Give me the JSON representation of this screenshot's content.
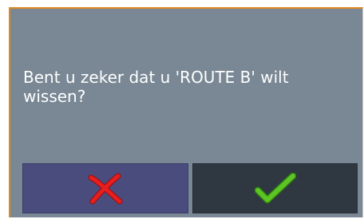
{
  "dialog": {
    "message": "Bent u zeker dat u 'ROUTE B' wilt\nwissen?",
    "buttons": {
      "cancel": {
        "icon": "red-x-icon",
        "color": "#e61e1e"
      },
      "confirm": {
        "icon": "green-check-icon",
        "color": "#4fb31a"
      }
    }
  }
}
